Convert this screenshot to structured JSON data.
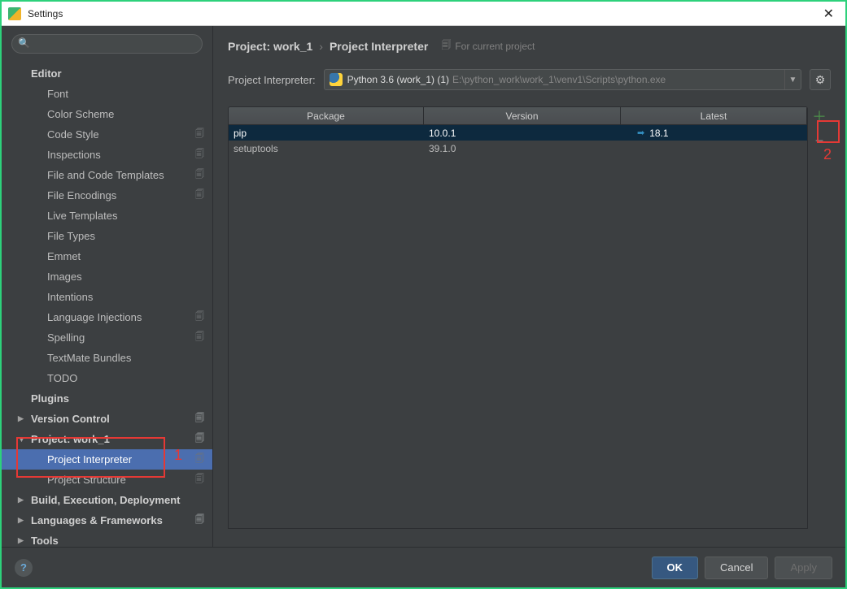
{
  "window": {
    "title": "Settings"
  },
  "breadcrumb": {
    "part1": "Project: work_1",
    "part2": "Project Interpreter",
    "sub": "For current project"
  },
  "interpRow": {
    "label": "Project Interpreter:",
    "selectedName": "Python 3.6 (work_1) (1)",
    "selectedPath": "E:\\python_work\\work_1\\venv1\\Scripts\\python.exe"
  },
  "sidebar": {
    "items": [
      {
        "label": "Editor",
        "level": 0,
        "bold": true,
        "arrow": "",
        "copy": false
      },
      {
        "label": "Font",
        "level": 1,
        "bold": false,
        "arrow": "",
        "copy": false
      },
      {
        "label": "Color Scheme",
        "level": 1,
        "bold": false,
        "arrow": "▶",
        "copy": false
      },
      {
        "label": "Code Style",
        "level": 1,
        "bold": false,
        "arrow": "▶",
        "copy": true
      },
      {
        "label": "Inspections",
        "level": 1,
        "bold": false,
        "arrow": "",
        "copy": true
      },
      {
        "label": "File and Code Templates",
        "level": 1,
        "bold": false,
        "arrow": "",
        "copy": true
      },
      {
        "label": "File Encodings",
        "level": 1,
        "bold": false,
        "arrow": "",
        "copy": true
      },
      {
        "label": "Live Templates",
        "level": 1,
        "bold": false,
        "arrow": "",
        "copy": false
      },
      {
        "label": "File Types",
        "level": 1,
        "bold": false,
        "arrow": "",
        "copy": false
      },
      {
        "label": "Emmet",
        "level": 1,
        "bold": false,
        "arrow": "▶",
        "copy": false
      },
      {
        "label": "Images",
        "level": 1,
        "bold": false,
        "arrow": "",
        "copy": false
      },
      {
        "label": "Intentions",
        "level": 1,
        "bold": false,
        "arrow": "",
        "copy": false
      },
      {
        "label": "Language Injections",
        "level": 1,
        "bold": false,
        "arrow": "",
        "copy": true
      },
      {
        "label": "Spelling",
        "level": 1,
        "bold": false,
        "arrow": "",
        "copy": true
      },
      {
        "label": "TextMate Bundles",
        "level": 1,
        "bold": false,
        "arrow": "",
        "copy": false
      },
      {
        "label": "TODO",
        "level": 1,
        "bold": false,
        "arrow": "",
        "copy": false
      },
      {
        "label": "Plugins",
        "level": 0,
        "bold": true,
        "arrow": "",
        "copy": false
      },
      {
        "label": "Version Control",
        "level": 0,
        "bold": true,
        "arrow": "▶",
        "copy": true
      },
      {
        "label": "Project: work_1",
        "level": 0,
        "bold": true,
        "arrow": "▼",
        "copy": true
      },
      {
        "label": "Project Interpreter",
        "level": 1,
        "bold": false,
        "arrow": "",
        "copy": true,
        "selected": true
      },
      {
        "label": "Project Structure",
        "level": 1,
        "bold": false,
        "arrow": "",
        "copy": true
      },
      {
        "label": "Build, Execution, Deployment",
        "level": 0,
        "bold": true,
        "arrow": "▶",
        "copy": false
      },
      {
        "label": "Languages & Frameworks",
        "level": 0,
        "bold": true,
        "arrow": "▶",
        "copy": true
      },
      {
        "label": "Tools",
        "level": 0,
        "bold": true,
        "arrow": "▶",
        "copy": false
      }
    ]
  },
  "table": {
    "columns": {
      "package": "Package",
      "version": "Version",
      "latest": "Latest"
    },
    "rows": [
      {
        "package": "pip",
        "version": "10.0.1",
        "latest": "18.1",
        "upgrade": true,
        "selected": true
      },
      {
        "package": "setuptools",
        "version": "39.1.0",
        "latest": "",
        "upgrade": false
      }
    ]
  },
  "footer": {
    "ok": "OK",
    "cancel": "Cancel",
    "apply": "Apply"
  },
  "annotations": {
    "one": "1",
    "two": "2"
  }
}
